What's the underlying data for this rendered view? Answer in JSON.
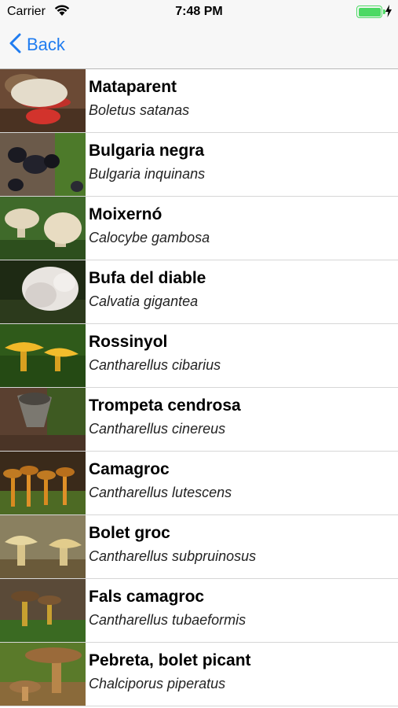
{
  "status_bar": {
    "carrier": "Carrier",
    "time": "7:48 PM",
    "battery_level": 1.0
  },
  "nav": {
    "back_label": "Back"
  },
  "list": {
    "items": [
      {
        "name": "Mataparent",
        "scientific": "Boletus satanas",
        "thumb": "red-pored-bolete-icon"
      },
      {
        "name": "Bulgaria negra",
        "scientific": "Bulgaria inquinans",
        "thumb": "black-cup-fungus-icon"
      },
      {
        "name": "Moixernó",
        "scientific": "Calocybe gambosa",
        "thumb": "pale-mushroom-icon"
      },
      {
        "name": "Bufa del diable",
        "scientific": "Calvatia gigantea",
        "thumb": "white-puffball-icon"
      },
      {
        "name": "Rossinyol",
        "scientific": "Cantharellus cibarius",
        "thumb": "yellow-chanterelle-icon"
      },
      {
        "name": "Trompeta cendrosa",
        "scientific": "Cantharellus cinereus",
        "thumb": "grey-trumpet-icon"
      },
      {
        "name": "Camagroc",
        "scientific": "Cantharellus lutescens",
        "thumb": "orange-cluster-icon"
      },
      {
        "name": "Bolet groc",
        "scientific": "Cantharellus subpruinosus",
        "thumb": "pale-chanterelle-icon"
      },
      {
        "name": "Fals camagroc",
        "scientific": "Cantharellus tubaeformis",
        "thumb": "brown-funnel-icon"
      },
      {
        "name": "Pebreta, bolet picant",
        "scientific": "Chalciporus piperatus",
        "thumb": "brown-bolete-icon"
      }
    ]
  }
}
